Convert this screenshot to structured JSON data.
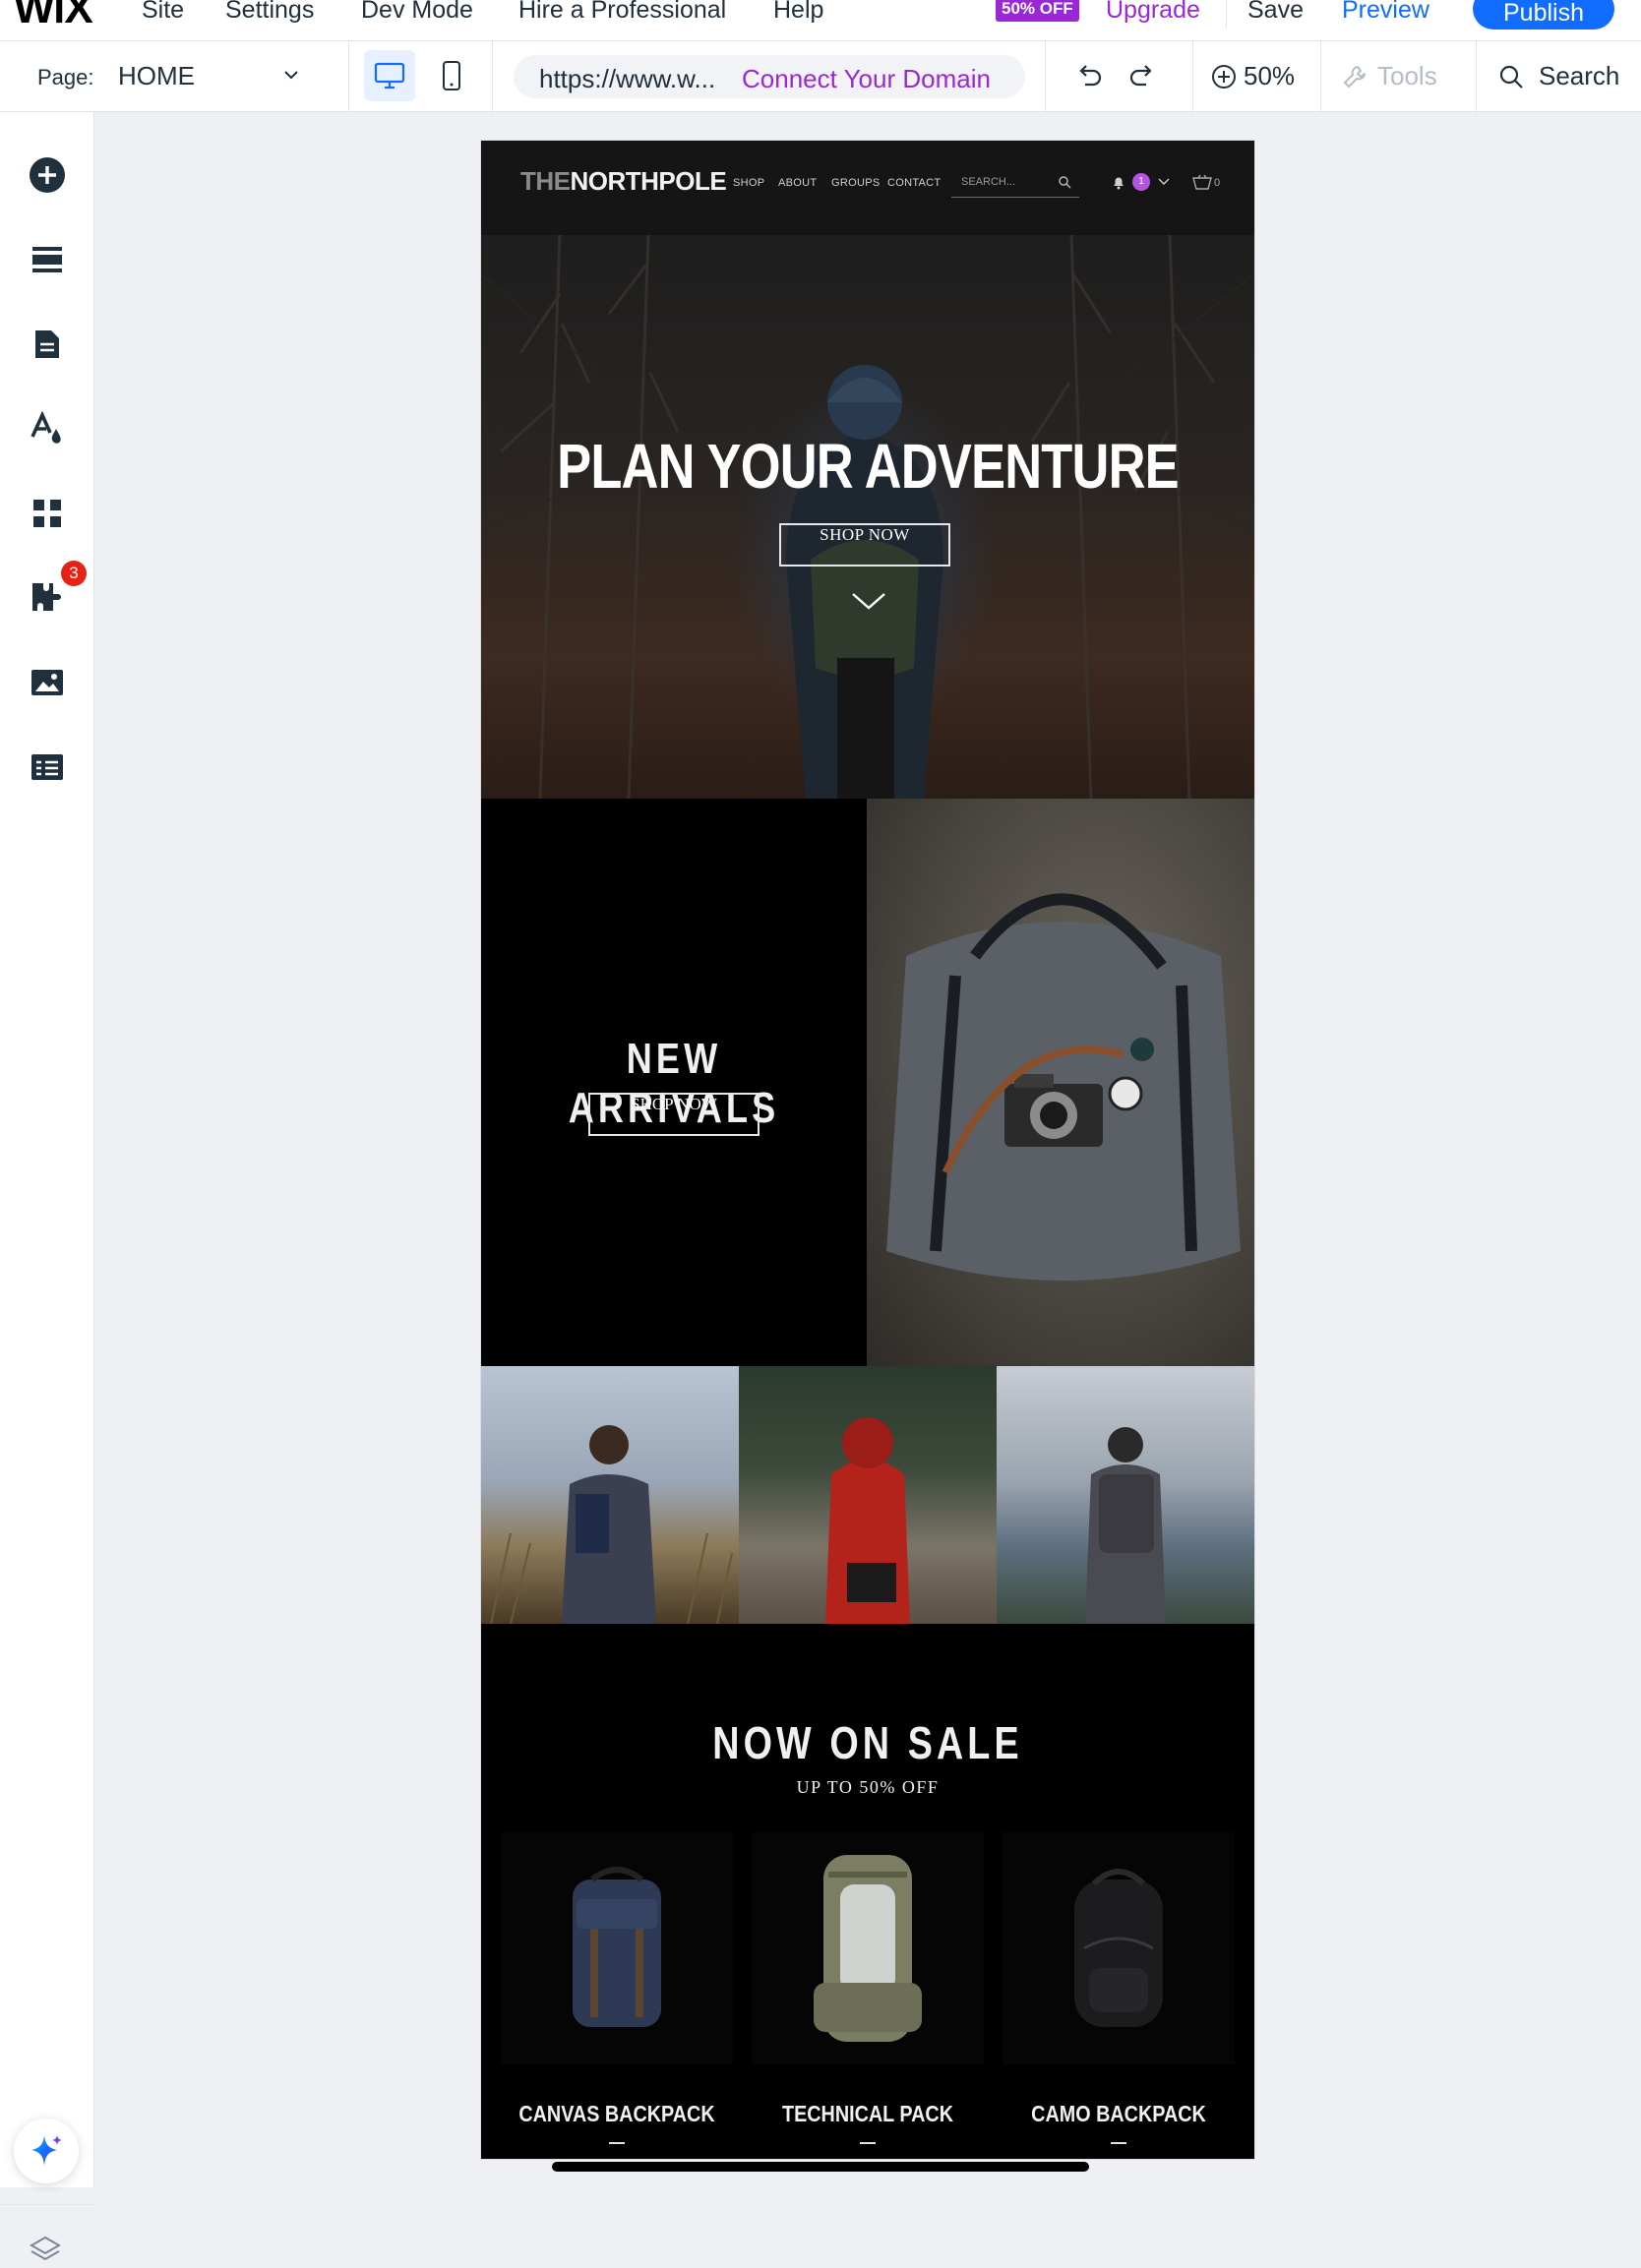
{
  "topbar": {
    "logo": "WiX",
    "menu": [
      "Site",
      "Settings",
      "Dev Mode",
      "Hire a Professional",
      "Help"
    ],
    "promo_badge": "50% OFF",
    "upgrade": "Upgrade",
    "save": "Save",
    "preview": "Preview",
    "publish": "Publish"
  },
  "toolbar": {
    "page_label": "Page:",
    "page_value": "HOME",
    "url": "https://www.w...",
    "connect_domain": "Connect Your Domain",
    "zoom": "50%",
    "tools": "Tools",
    "search": "Search"
  },
  "rail": {
    "badge_count": "3",
    "icons": [
      "add-elements-icon",
      "sections-icon",
      "pages-icon",
      "site-design-icon",
      "apps-icon",
      "business-tools-icon",
      "media-icon",
      "cms-icon"
    ]
  },
  "site": {
    "brand_the": "THE",
    "brand_name": "NORTHPOLE",
    "nav": [
      "SHOP",
      "ABOUT",
      "GROUPS",
      "CONTACT"
    ],
    "search_placeholder": "SEARCH...",
    "notif_count": "1",
    "cart_count": "0",
    "hero": {
      "title": "PLAN YOUR ADVENTURE",
      "button": "SHOP NOW"
    },
    "arrivals": {
      "title": "NEW ARRIVALS",
      "button": "SHOP NOW"
    },
    "sale": {
      "title": "NOW ON SALE",
      "subtitle": "UP TO 50% OFF",
      "products": [
        {
          "name": "CANVAS BACKPACK"
        },
        {
          "name": "TECHNICAL PACK"
        },
        {
          "name": "CAMO BACKPACK"
        }
      ]
    }
  },
  "colors": {
    "accent_blue": "#116dff",
    "accent_purple": "#9a27d5",
    "badge_red": "#e62214"
  }
}
